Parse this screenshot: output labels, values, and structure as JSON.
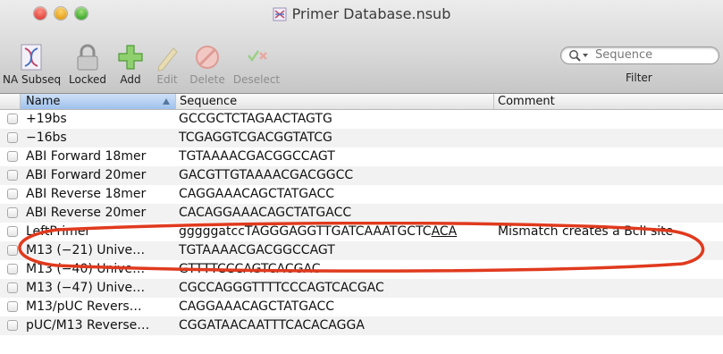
{
  "window": {
    "title": "Primer Database.nsub"
  },
  "toolbar": {
    "buttons": [
      {
        "label": "NA Subseq",
        "icon": "na-subseq-icon",
        "enabled": true
      },
      {
        "label": "Locked",
        "icon": "lock-icon",
        "enabled": true
      },
      {
        "label": "Add",
        "icon": "plus-icon",
        "enabled": true
      },
      {
        "label": "Edit",
        "icon": "pencil-icon",
        "enabled": false
      },
      {
        "label": "Delete",
        "icon": "prohibited-icon",
        "enabled": false
      },
      {
        "label": "Deselect",
        "icon": "deselect-icon",
        "enabled": false
      }
    ],
    "search_placeholder": "Sequence",
    "filter_label": "Filter"
  },
  "table": {
    "columns": [
      "Name",
      "Sequence",
      "Comment"
    ],
    "sorted_column": "Name",
    "rows": [
      {
        "name": "+19bs",
        "sequence": "GCCGCTCTAGAACTAGTG",
        "comment": ""
      },
      {
        "name": "−16bs",
        "sequence": "TCGAGGTCGACGGTATCG",
        "comment": ""
      },
      {
        "name": "ABI Forward 18mer",
        "sequence": "TGTAAAACGACGGCCAGT",
        "comment": ""
      },
      {
        "name": "ABI Forward 20mer",
        "sequence": "GACGTTGTAAAACGACGGCC",
        "comment": ""
      },
      {
        "name": "ABI Reverse 18mer",
        "sequence": "CAGGAAACAGCTATGACC",
        "comment": ""
      },
      {
        "name": "ABI Reverse 20mer",
        "sequence": "CACAGGAAACAGCTATGACC",
        "comment": ""
      },
      {
        "name": "LeftPrimer",
        "sequence_plain": "gggggatccTAGGGAGGTTGATCAAATGCTC",
        "sequence_underlined": "ACA",
        "comment": "Mismatch creates a BclI site",
        "highlighted": true
      },
      {
        "name": "M13 (−21) Unive…",
        "sequence": "TGTAAAACGACGGCCAGT",
        "comment": ""
      },
      {
        "name": "M13 (−40) Unive…",
        "sequence": "GTTTTCCCAGTCACGAC",
        "comment": ""
      },
      {
        "name": "M13 (−47) Unive…",
        "sequence": "CGCCAGGGTTTTCCCAGTCACGAC",
        "comment": ""
      },
      {
        "name": "M13/pUC Revers…",
        "sequence": "CAGGAAACAGCTATGACC",
        "comment": ""
      },
      {
        "name": "pUC/M13 Reverse…",
        "sequence": "CGGATAACAATTTCACACAGGA",
        "comment": ""
      }
    ]
  },
  "annotation_color": "#e03a1e"
}
